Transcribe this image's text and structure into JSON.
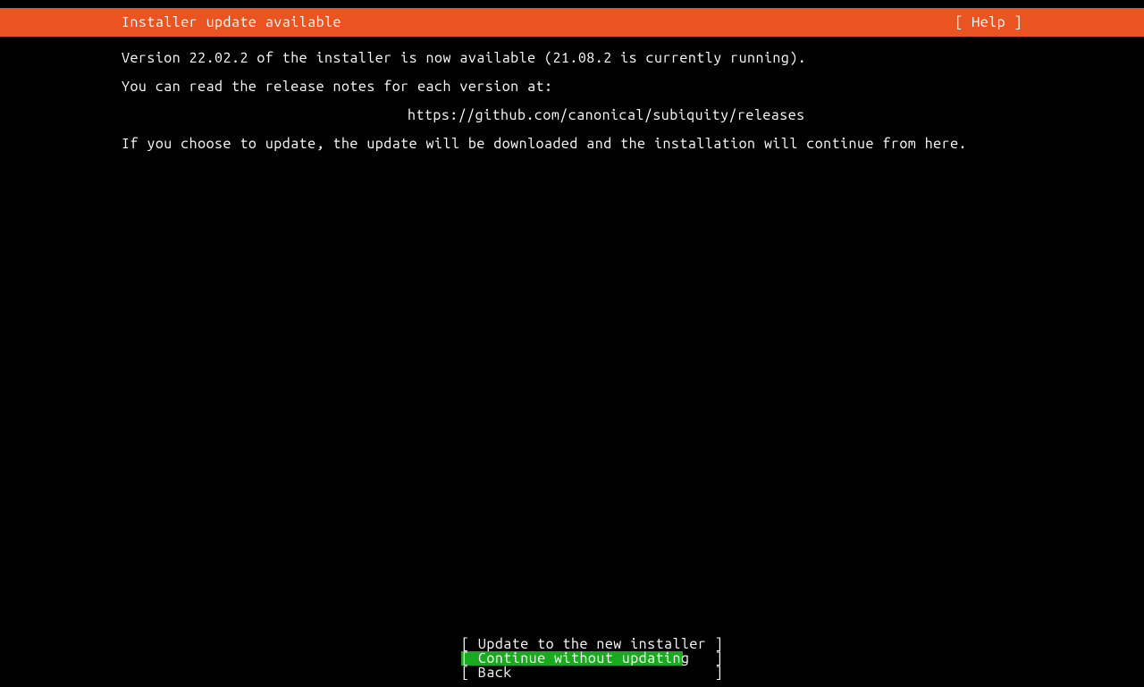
{
  "header": {
    "title": "Installer update available",
    "help": "[ Help ]"
  },
  "body": {
    "line1": "Version 22.02.2 of the installer is now available (21.08.2 is currently running).",
    "line2": "You can read the release notes for each version at:",
    "url": "https://github.com/canonical/subiquity/releases",
    "line3": "If you choose to update, the update will be downloaded and the installation will continue from here."
  },
  "buttons": {
    "update": "[ Update to the new installer ]",
    "continue": "[ Continue without updating   ]",
    "back": "[ Back                        ]"
  }
}
